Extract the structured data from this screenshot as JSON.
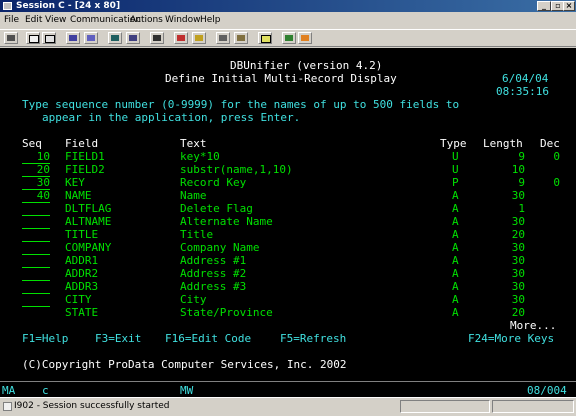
{
  "window": {
    "title": "Session C - [24 x 80]"
  },
  "menu": [
    "File",
    "Edit",
    "View",
    "Communication",
    "Actions",
    "Window",
    "Help"
  ],
  "toolbar_icons": [
    "print-icon",
    "copy-icon",
    "paste-icon",
    "send-icon",
    "receive-icon",
    "display-icon",
    "color-icon",
    "keyboard-icon",
    "macro-record-icon",
    "macro-play-icon",
    "macro-stop-icon",
    "clipboard-icon",
    "map-icon",
    "settings-icon",
    "help-icon"
  ],
  "screen": {
    "app_title": "DBUnifier (version 4.2)",
    "page_title": "Define Initial Multi-Record Display",
    "date": "6/04/04",
    "time": "08:35:16",
    "instruction_line1": "Type sequence number (0-9999) for the names of up to 500 fields to",
    "instruction_line2": "appear in the application, press Enter.",
    "headers": {
      "seq": "Seq",
      "field": "Field",
      "text": "Text",
      "type": "Type",
      "length": "Length",
      "dec": "Dec"
    },
    "rows": [
      {
        "seq": "10",
        "field": "FIELD1",
        "text": "key*10",
        "type": "U",
        "length": "9",
        "dec": "0"
      },
      {
        "seq": "20",
        "field": "FIELD2",
        "text": "substr(name,1,10)",
        "type": "U",
        "length": "10",
        "dec": ""
      },
      {
        "seq": "30",
        "field": "KEY",
        "text": "Record Key",
        "type": "P",
        "length": "9",
        "dec": "0"
      },
      {
        "seq": "40",
        "field": "NAME",
        "text": "Name",
        "type": "A",
        "length": "30",
        "dec": ""
      },
      {
        "seq": "",
        "field": "DLTFLAG",
        "text": "Delete Flag",
        "type": "A",
        "length": "1",
        "dec": ""
      },
      {
        "seq": "",
        "field": "ALTNAME",
        "text": "Alternate Name",
        "type": "A",
        "length": "30",
        "dec": ""
      },
      {
        "seq": "",
        "field": "TITLE",
        "text": "Title",
        "type": "A",
        "length": "20",
        "dec": ""
      },
      {
        "seq": "",
        "field": "COMPANY",
        "text": "Company Name",
        "type": "A",
        "length": "30",
        "dec": ""
      },
      {
        "seq": "",
        "field": "ADDR1",
        "text": "Address #1",
        "type": "A",
        "length": "30",
        "dec": ""
      },
      {
        "seq": "",
        "field": "ADDR2",
        "text": "Address #2",
        "type": "A",
        "length": "30",
        "dec": ""
      },
      {
        "seq": "",
        "field": "ADDR3",
        "text": "Address #3",
        "type": "A",
        "length": "30",
        "dec": ""
      },
      {
        "seq": "",
        "field": "CITY",
        "text": "City",
        "type": "A",
        "length": "30",
        "dec": ""
      },
      {
        "seq": "",
        "field": "STATE",
        "text": "State/Province",
        "type": "A",
        "length": "20",
        "dec": ""
      }
    ],
    "more": "More...",
    "fkeys": {
      "f1": "F1=Help",
      "f3": "F3=Exit",
      "f16": "F16=Edit Code",
      "f5": "F5=Refresh",
      "f24": "F24=More Keys"
    },
    "copyright": "(C)Copyright ProData Computer Services, Inc. 2002"
  },
  "oia": {
    "left": "MA",
    "mode": "c",
    "mw": "MW",
    "pos": "08/004"
  },
  "status": {
    "message": "I902 - Session successfully started"
  }
}
